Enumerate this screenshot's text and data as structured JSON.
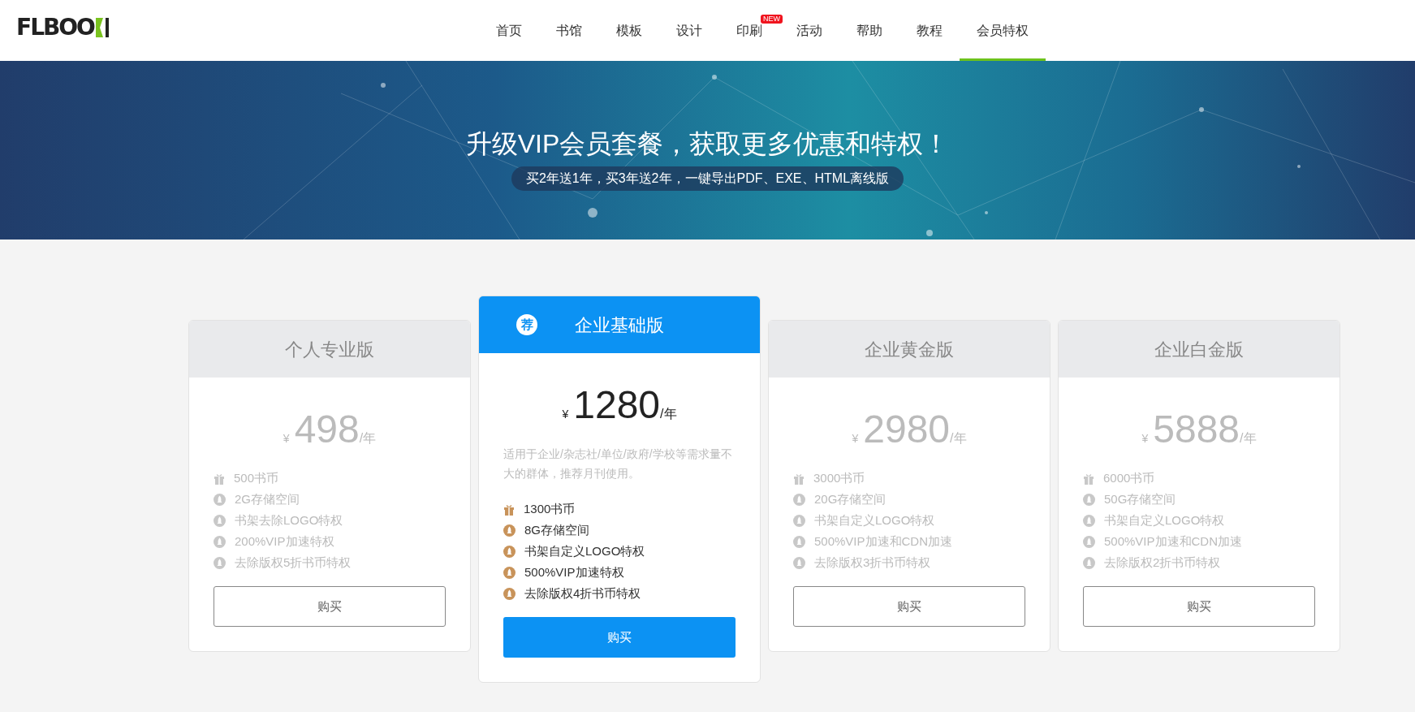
{
  "logo": {
    "text": "FLBOO"
  },
  "nav": [
    {
      "label": "首页",
      "selected": false
    },
    {
      "label": "书馆",
      "selected": false
    },
    {
      "label": "模板",
      "selected": false
    },
    {
      "label": "设计",
      "selected": false
    },
    {
      "label": "印刷",
      "selected": false,
      "badge": "NEW"
    },
    {
      "label": "活动",
      "selected": false
    },
    {
      "label": "帮助",
      "selected": false
    },
    {
      "label": "教程",
      "selected": false
    },
    {
      "label": "会员特权",
      "selected": true
    }
  ],
  "banner": {
    "title": "升级VIP会员套餐，获取更多优惠和特权！",
    "subtitle": "买2年送1年，买3年送2年，一键导出PDF、EXE、HTML离线版"
  },
  "plans": [
    {
      "name": "个人专业版",
      "featured": false,
      "currency": "¥",
      "price": "498",
      "unit": "/年",
      "features": [
        {
          "kind": "gift",
          "text": "500书币"
        },
        {
          "kind": "rocket",
          "text": "2G存储空间"
        },
        {
          "kind": "rocket",
          "text": "书架去除LOGO特权"
        },
        {
          "kind": "rocket",
          "text": "200%VIP加速特权"
        },
        {
          "kind": "rocket",
          "text": "去除版权5折书币特权"
        }
      ],
      "button": "购买"
    },
    {
      "name": "企业基础版",
      "featured": true,
      "badge": "荐",
      "currency": "¥",
      "price": "1280",
      "unit": "/年",
      "description": "适用于企业/杂志社/单位/政府/学校等需求量不大的群体，推荐月刊使用。",
      "features": [
        {
          "kind": "gift",
          "text": "1300书币"
        },
        {
          "kind": "rocket",
          "text": "8G存储空间"
        },
        {
          "kind": "rocket",
          "text": "书架自定义LOGO特权"
        },
        {
          "kind": "rocket",
          "text": "500%VIP加速特权"
        },
        {
          "kind": "rocket",
          "text": "去除版权4折书币特权"
        }
      ],
      "button": "购买"
    },
    {
      "name": "企业黄金版",
      "featured": false,
      "currency": "¥",
      "price": "2980",
      "unit": "/年",
      "features": [
        {
          "kind": "gift",
          "text": "3000书币"
        },
        {
          "kind": "rocket",
          "text": "20G存储空间"
        },
        {
          "kind": "rocket",
          "text": "书架自定义LOGO特权"
        },
        {
          "kind": "rocket",
          "text": "500%VIP加速和CDN加速"
        },
        {
          "kind": "rocket",
          "text": "去除版权3折书币特权"
        }
      ],
      "button": "购买"
    },
    {
      "name": "企业白金版",
      "featured": false,
      "currency": "¥",
      "price": "5888",
      "unit": "/年",
      "features": [
        {
          "kind": "gift",
          "text": "6000书币"
        },
        {
          "kind": "rocket",
          "text": "50G存储空间"
        },
        {
          "kind": "rocket",
          "text": "书架自定义LOGO特权"
        },
        {
          "kind": "rocket",
          "text": "500%VIP加速和CDN加速"
        },
        {
          "kind": "rocket",
          "text": "去除版权2折书币特权"
        }
      ],
      "button": "购买"
    }
  ]
}
